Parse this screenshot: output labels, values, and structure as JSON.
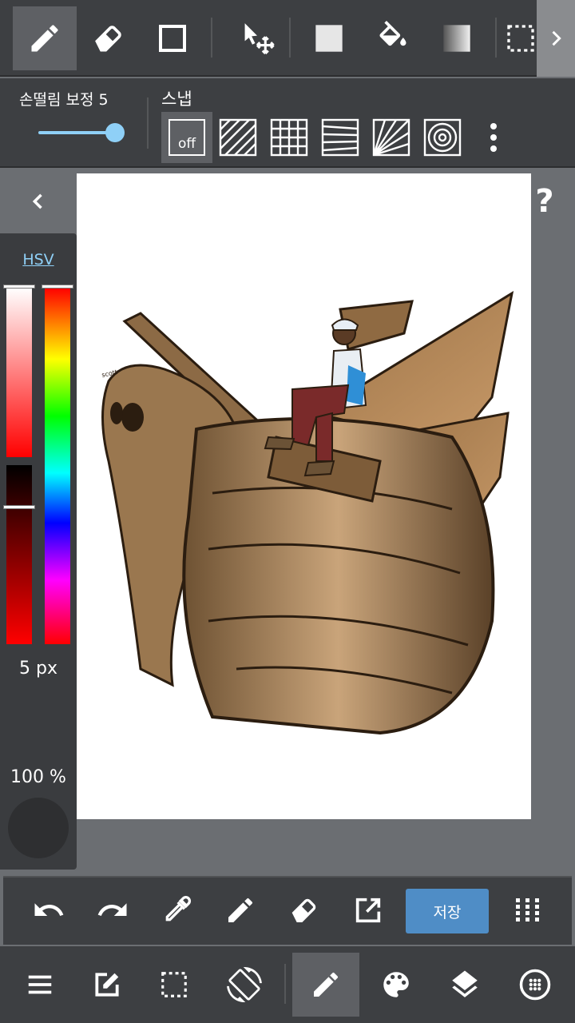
{
  "toolbar": {
    "tools": [
      "pen",
      "eraser",
      "shape",
      "move",
      "fill-color",
      "bucket",
      "gradient",
      "selection"
    ],
    "active_tool": "pen"
  },
  "stabilizer": {
    "label": "손떨림 보정 5",
    "value": 5
  },
  "snap": {
    "label": "스냅",
    "off_label": "off",
    "active": "off"
  },
  "color_panel": {
    "mode_label": "HSV",
    "brush_size_label": "5 px",
    "opacity_label": "100 %",
    "current_color": "#ff0000",
    "accent_color": "#8fd0f7"
  },
  "help": {
    "label": "?"
  },
  "actions": {
    "save_label": "저장",
    "save_color": "#4f8dc6"
  },
  "nav": {
    "active": "brush"
  },
  "artwork": {
    "signature": "scott"
  }
}
